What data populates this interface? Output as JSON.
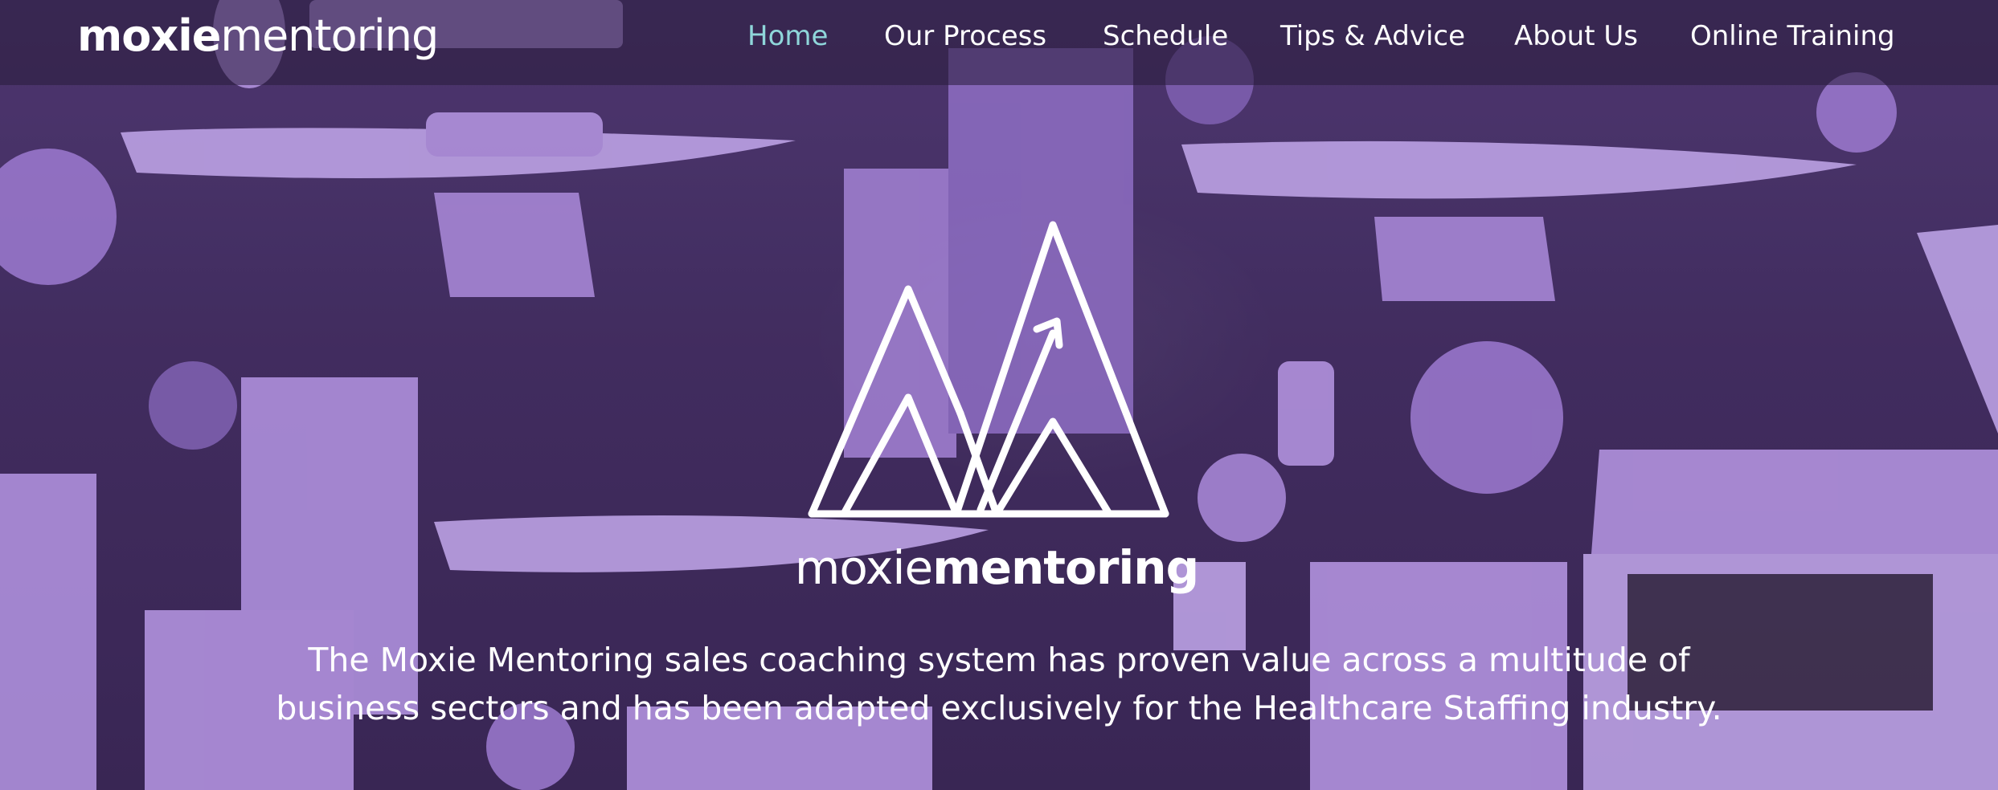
{
  "header": {
    "brand_part1": "moxie",
    "brand_part2": "mentoring"
  },
  "nav": {
    "items": [
      {
        "label": "Home",
        "active": true
      },
      {
        "label": "Our Process",
        "active": false
      },
      {
        "label": "Schedule",
        "active": false
      },
      {
        "label": "Tips & Advice",
        "active": false
      },
      {
        "label": "About Us",
        "active": false
      },
      {
        "label": "Online Training",
        "active": false
      }
    ]
  },
  "hero": {
    "logo_icon": "mountain-peaks-arrow-icon",
    "logo_word_part1": "moxie",
    "logo_word_part2": "mentoring",
    "tagline_line1": "The Moxie Mentoring sales coaching system has proven value across a multitude of",
    "tagline_line2": "business sectors and has been adapted exclusively for the Healthcare Staffing industry."
  },
  "colors": {
    "accent": "#8fd6da",
    "overlay": "#8962c4",
    "text": "#ffffff"
  }
}
